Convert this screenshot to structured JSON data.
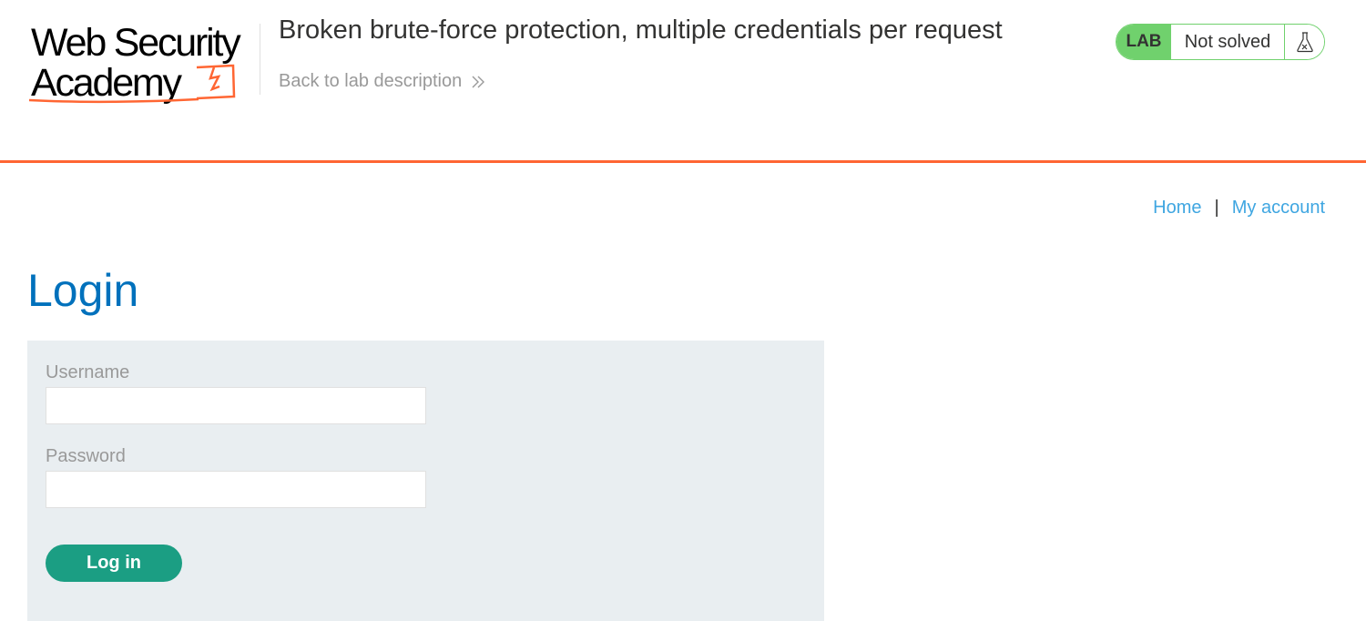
{
  "header": {
    "logo": {
      "line1": "Web Security",
      "line2": "Academy"
    },
    "lab_title": "Broken brute-force protection, multiple credentials per request",
    "back_link": "Back to lab description",
    "status": {
      "badge": "LAB",
      "text": "Not solved",
      "icon": "flask-icon"
    }
  },
  "nav": {
    "home": "Home",
    "separator": "|",
    "account": "My account"
  },
  "main": {
    "title": "Login",
    "form": {
      "username_label": "Username",
      "username_value": "",
      "password_label": "Password",
      "password_value": "",
      "submit_label": "Log in"
    }
  },
  "colors": {
    "accent_orange": "#ff6633",
    "lab_green": "#70d16d",
    "button_green": "#1b9e83",
    "link_blue": "#3fa6e1",
    "title_blue": "#0071bc",
    "panel_bg": "#e9eef1"
  }
}
